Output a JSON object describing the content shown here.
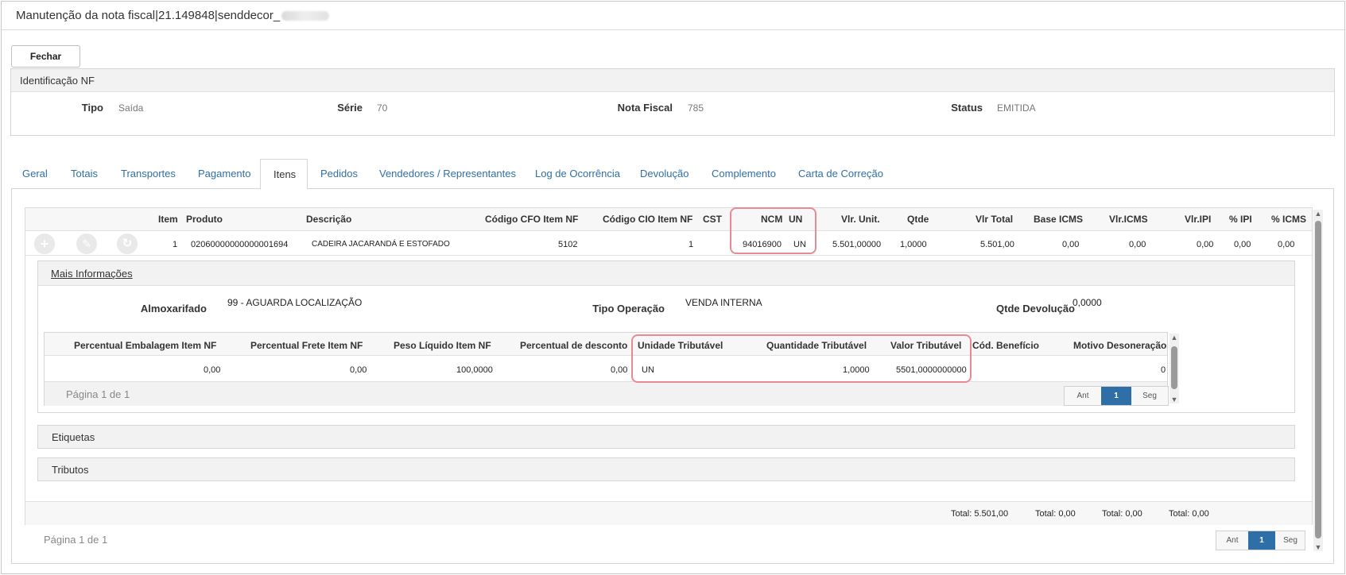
{
  "window": {
    "title": "Manutenção da nota fiscal|21.149848|senddecor_"
  },
  "toolbar": {
    "close_label": "Fechar"
  },
  "identificacao": {
    "title": "Identificação NF",
    "tipo_label": "Tipo",
    "tipo_value": "Saída",
    "serie_label": "Série",
    "serie_value": "70",
    "nota_label": "Nota Fiscal",
    "nota_value": "785",
    "status_label": "Status",
    "status_value": "EMITIDA"
  },
  "tabs": [
    {
      "label": "Geral"
    },
    {
      "label": "Totais"
    },
    {
      "label": "Transportes"
    },
    {
      "label": "Pagamento"
    },
    {
      "label": "Itens"
    },
    {
      "label": "Pedidos"
    },
    {
      "label": "Vendedores / Representantes"
    },
    {
      "label": "Log de Ocorrência"
    },
    {
      "label": "Devolução"
    },
    {
      "label": "Complemento"
    },
    {
      "label": "Carta de Correção"
    }
  ],
  "items_grid": {
    "headers": {
      "item": "Item",
      "produto": "Produto",
      "descricao": "Descrição",
      "cfo": "Código CFO Item NF",
      "cio": "Código CIO Item NF",
      "cst": "CST",
      "ncm": "NCM",
      "un": "UN",
      "vlr_unit": "Vlr. Unit.",
      "qtde": "Qtde",
      "vlr_total": "Vlr Total",
      "base_icms": "Base ICMS",
      "vlr_icms": "Vlr.ICMS",
      "vlr_ipi": "Vlr.IPI",
      "pct_ipi": "% IPI",
      "pct_icms": "% ICMS"
    },
    "row": {
      "item": "1",
      "produto": "02060000000000001694",
      "descricao": "CADEIRA JACARANDÁ E ESTOFADO",
      "cfo": "5102",
      "cio": "1",
      "ncm": "94016900",
      "un": "UN",
      "vlr_unit": "5.501,00000",
      "qtde": "1,0000",
      "vlr_total": "5.501,00",
      "base_icms": "0,00",
      "vlr_icms": "0,00",
      "vlr_ipi": "0,00",
      "pct_ipi": "0,00",
      "pct_icms": "0,00"
    },
    "totals": {
      "t1": "Total: 5.501,00",
      "t2": "Total: 0,00",
      "t3": "Total: 0,00",
      "t4": "Total: 0,00"
    },
    "pager": {
      "info": "Página 1 de 1",
      "prev": "Ant",
      "page": "1",
      "next": "Seg"
    }
  },
  "mais_info": {
    "title": "Mais Informações",
    "almox_label": "Almoxarifado",
    "almox_value": "99 - AGUARDA LOCALIZAÇÃO",
    "tipo_op_label": "Tipo Operação",
    "tipo_op_value": "VENDA INTERNA",
    "qtde_dev_label": "Qtde Devolução",
    "qtde_dev_value": "0,0000",
    "headers": {
      "embalagem": "Percentual Embalagem Item NF",
      "frete": "Percentual Frete Item NF",
      "peso": "Peso Líquido Item NF",
      "desconto": "Percentual de desconto",
      "unid_trib": "Unidade Tributável",
      "qtd_trib": "Quantidade Tributável",
      "valor_trib": "Valor Tributável",
      "cod_benef": "Cód. Benefício",
      "motivo": "Motivo Desoneração"
    },
    "row": {
      "embalagem": "0,00",
      "frete": "0,00",
      "peso": "100,0000",
      "desconto": "0,00",
      "unid_trib": "UN",
      "qtd_trib": "1,0000",
      "valor_trib": "5501,0000000000",
      "cod_benef": "",
      "motivo": "0"
    },
    "pager": {
      "info": "Página 1 de 1",
      "prev": "Ant",
      "page": "1",
      "next": "Seg"
    }
  },
  "sections": {
    "etiquetas": "Etiquetas",
    "tributos": "Tributos"
  },
  "icons": {
    "add": "+",
    "edit": "✎",
    "history": "↻"
  },
  "colors": {
    "link": "#2f6fa7",
    "highlight": "#e88a95",
    "pager_active": "#2f6fa7"
  }
}
